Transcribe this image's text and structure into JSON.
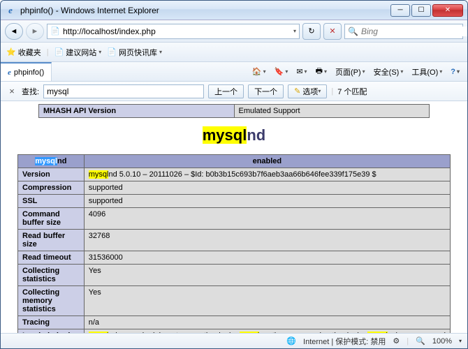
{
  "window": {
    "title": "phpinfo() - Windows Internet Explorer"
  },
  "nav": {
    "url": "http://localhost/index.php"
  },
  "search": {
    "placeholder": "Bing"
  },
  "favbar": {
    "label": "收藏夹",
    "suggest": "建议网站",
    "quick": "网页快讯库"
  },
  "tab": {
    "label": "phpinfo()"
  },
  "toolbar": {
    "page": "页面(P)",
    "safety": "安全(S)",
    "tools": "工具(O)"
  },
  "findbar": {
    "label": "查找:",
    "value": "mysql",
    "prev": "上一个",
    "next": "下一个",
    "options": "选项",
    "matches": "7 个匹配"
  },
  "toptable": {
    "h": "MHASH API Version",
    "v": "Emulated Support"
  },
  "mod": {
    "hl": "mysql",
    "suffix": "nd"
  },
  "thead": {
    "c1_hl": "mysql",
    "c1_suffix": "nd",
    "c2": "enabled"
  },
  "rows": [
    {
      "label": "Version",
      "val_hl1": "mysql",
      "val_rest": "nd 5.0.10 – 20111026 – $Id: b0b3b15c693b7f6aeb3aa66b646fee339f175e39 $"
    },
    {
      "label": "Compression",
      "val_plain": "supported"
    },
    {
      "label": "SSL",
      "val_plain": "supported"
    },
    {
      "label": "Command buffer size",
      "val_plain": "4096"
    },
    {
      "label": "Read buffer size",
      "val_plain": "32768"
    },
    {
      "label": "Read timeout",
      "val_plain": "31536000"
    },
    {
      "label": "Collecting statistics",
      "val_plain": "Yes"
    },
    {
      "label": "Collecting memory statistics",
      "val_plain": "Yes"
    },
    {
      "label": "Tracing",
      "val_plain": "n/a"
    },
    {
      "label": "Loaded plugins",
      "val_hl1": "mysql",
      "val_mid1": "nd,example,debug_trace,auth_plugin_",
      "val_hl2": "mysql",
      "val_mid2": "_native_password,auth_plugin_",
      "val_hl3": "mysql",
      "val_mid3": "_clear_password"
    }
  ],
  "status": {
    "zone": "Internet | 保护模式: 禁用",
    "zoom": "100%"
  }
}
